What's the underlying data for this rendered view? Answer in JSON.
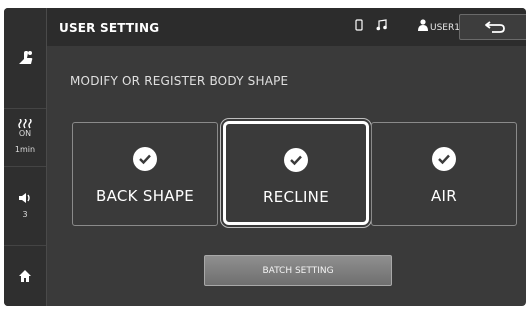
{
  "header": {
    "title": "USER SETTING",
    "user": "USER1"
  },
  "sidebar": {
    "heat_status": "ON",
    "heat_timer": "1min",
    "volume": "3"
  },
  "main": {
    "subtitle": "MODIFY OR REGISTER BODY SHAPE",
    "options": [
      {
        "label": "BACK SHAPE",
        "checked": true,
        "selected": false
      },
      {
        "label": "RECLINE",
        "checked": true,
        "selected": true
      },
      {
        "label": "AIR",
        "checked": true,
        "selected": false
      }
    ],
    "batch_label": "BATCH SETTING"
  },
  "colors": {
    "background": "#3a3a3a",
    "button": "#7f7f7f",
    "text": "#ffffff"
  }
}
